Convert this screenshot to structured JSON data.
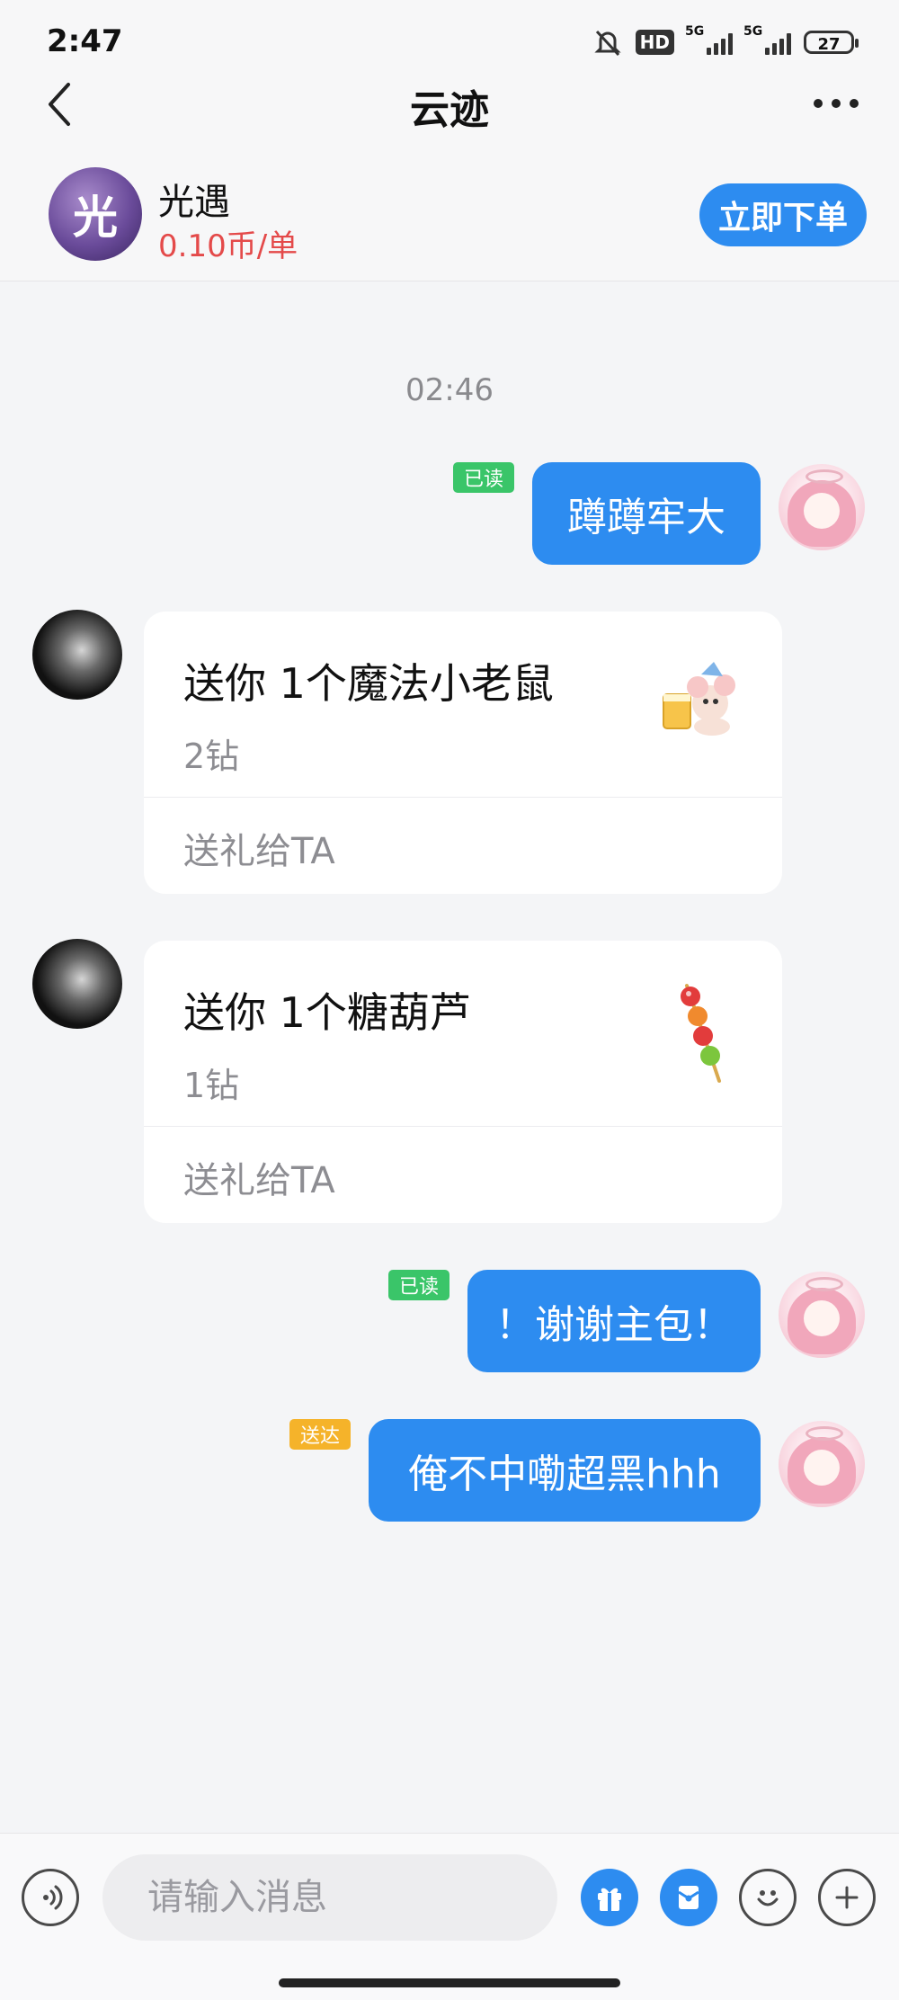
{
  "status_bar": {
    "time": "2:47",
    "hd_label": "HD",
    "net1": "5G",
    "net2": "5G",
    "battery": "27"
  },
  "nav": {
    "title": "云迹"
  },
  "service": {
    "logo_text": "光",
    "name": "光遇",
    "price": "0.10币/单",
    "order_button": "立即下单"
  },
  "chat": {
    "timestamp": "02:46",
    "messages": [
      {
        "type": "text",
        "side": "right",
        "text": "蹲蹲牢大",
        "status": "已读"
      },
      {
        "type": "gift",
        "side": "left",
        "title": "送你 1个魔法小老鼠",
        "price": "2钻",
        "action": "送礼给TA",
        "icon": "magic-mouse-icon"
      },
      {
        "type": "gift",
        "side": "left",
        "title": "送你 1个糖葫芦",
        "price": "1钻",
        "action": "送礼给TA",
        "icon": "candied-haws-icon"
      },
      {
        "type": "text",
        "side": "right",
        "text": "！谢谢主包！",
        "status": "已读"
      },
      {
        "type": "text",
        "side": "right",
        "text": "俺不中嘞超黑hhh",
        "status": "送达"
      }
    ]
  },
  "input": {
    "placeholder": "请输入消息"
  },
  "colors": {
    "accent": "#2d8cf0",
    "price_red": "#e44a4a",
    "read_green": "#3ac569",
    "delivered_orange": "#f5b32a",
    "background": "#f4f5f7"
  }
}
